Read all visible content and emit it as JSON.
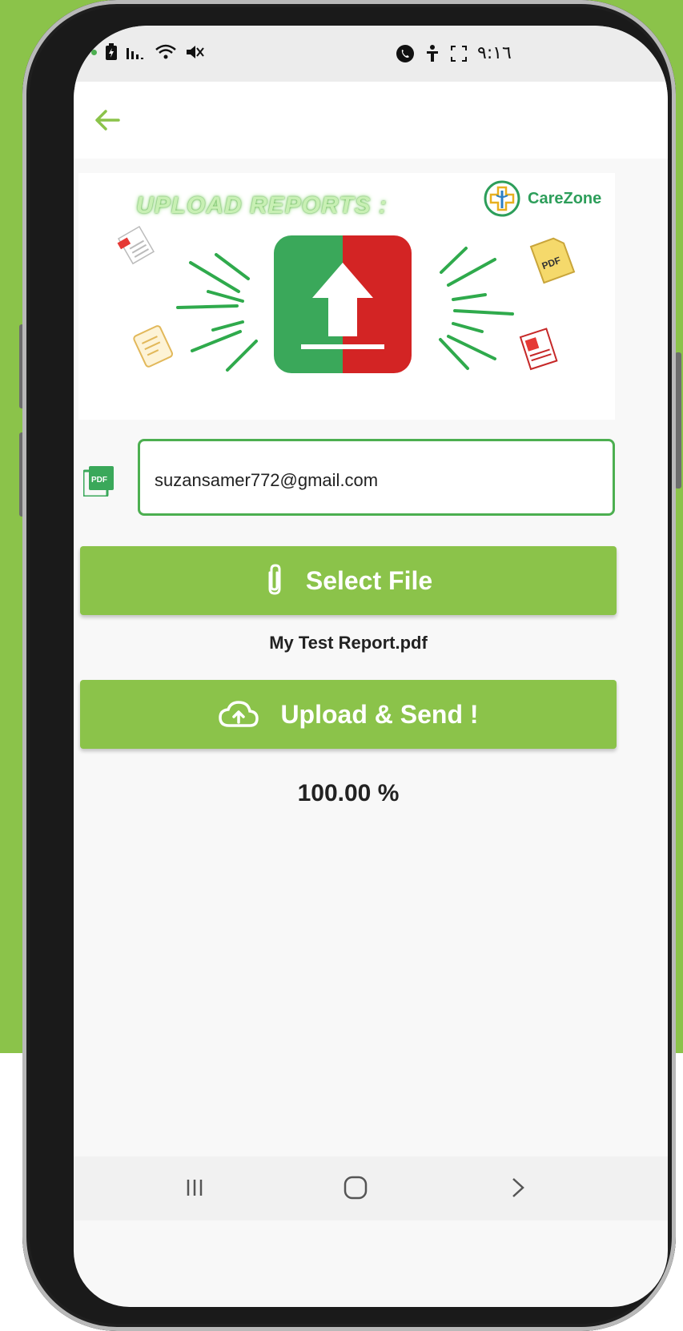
{
  "status_bar": {
    "time": "٩:١٦",
    "icons_left": [
      "charging-dot",
      "battery-icon",
      "signal-icon",
      "wifi-icon",
      "mute-icon"
    ],
    "icons_right": [
      "phone-call-icon",
      "accessibility-icon",
      "screenshot-frame-icon"
    ]
  },
  "app_bar": {
    "back_icon": "arrow-left-icon",
    "accent": "#8bc34a"
  },
  "banner": {
    "title": "UPLOAD REPORTS :",
    "logo_text": "CareZone",
    "center_icon": "upload-arrow-icon"
  },
  "form": {
    "field_icon": "pdf-icon",
    "field_icon_text": "PDF",
    "email_value": "suzansamer772@gmail.com",
    "select_button_label": "Select File",
    "select_button_icon": "paperclip-icon",
    "selected_file": "My Test Report.pdf",
    "upload_button_label": "Upload & Send !",
    "upload_button_icon": "cloud-upload-icon",
    "progress_text": "100.00 %",
    "progress_value": 100
  },
  "nav_bar": {
    "items": [
      "recent-apps-icon",
      "home-icon",
      "back-chevron-icon"
    ]
  },
  "colors": {
    "background_green": "#8bc34a",
    "button_green": "#8bc34a",
    "field_border": "#4caf50",
    "upload_tile_left": "#3aa85a",
    "upload_tile_right": "#d32424"
  }
}
